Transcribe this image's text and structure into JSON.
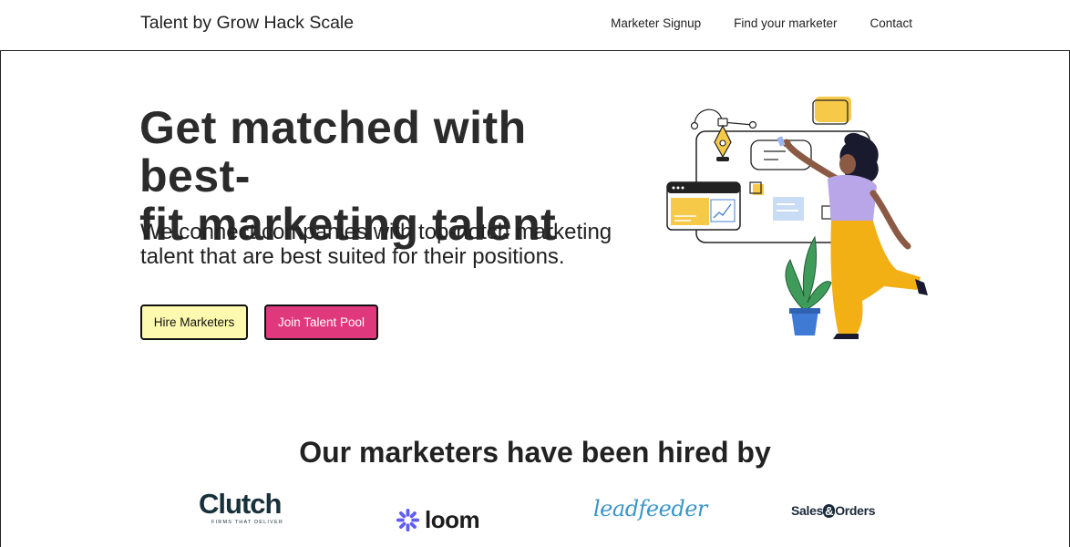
{
  "nav": {
    "brand": "Talent by Grow Hack Scale",
    "links": [
      "Marketer Signup",
      "Find your marketer",
      "Contact"
    ]
  },
  "hero": {
    "headline_line1": "Get matched with best-",
    "headline_line2": "fit marketing talent",
    "subline_line1": "We connect companies with top-notch marketing",
    "subline_line2": "talent that are best suited for their positions.",
    "buttons": {
      "hire": "Hire Marketers",
      "join": "Join Talent Pool"
    },
    "illustration_icon": "designer-at-whiteboard-illustration"
  },
  "clients": {
    "title": "Our marketers have been hired by",
    "logos": {
      "clutch_text": "Clutch",
      "clutch_sub": "FIRMS THAT DELIVER",
      "loom_text": "loom",
      "leadfeeder_text": "leadfeeder",
      "sales_text_1": "Sales",
      "sales_amp": "&",
      "sales_text_2": "Orders"
    }
  },
  "colors": {
    "hire_button": "#fdfab0",
    "join_button": "#e0387c",
    "accent_yellow": "#f7c948",
    "purple": "#b9a6e8",
    "loom_purple": "#625df5",
    "leadfeeder_blue": "#3a96c8"
  }
}
